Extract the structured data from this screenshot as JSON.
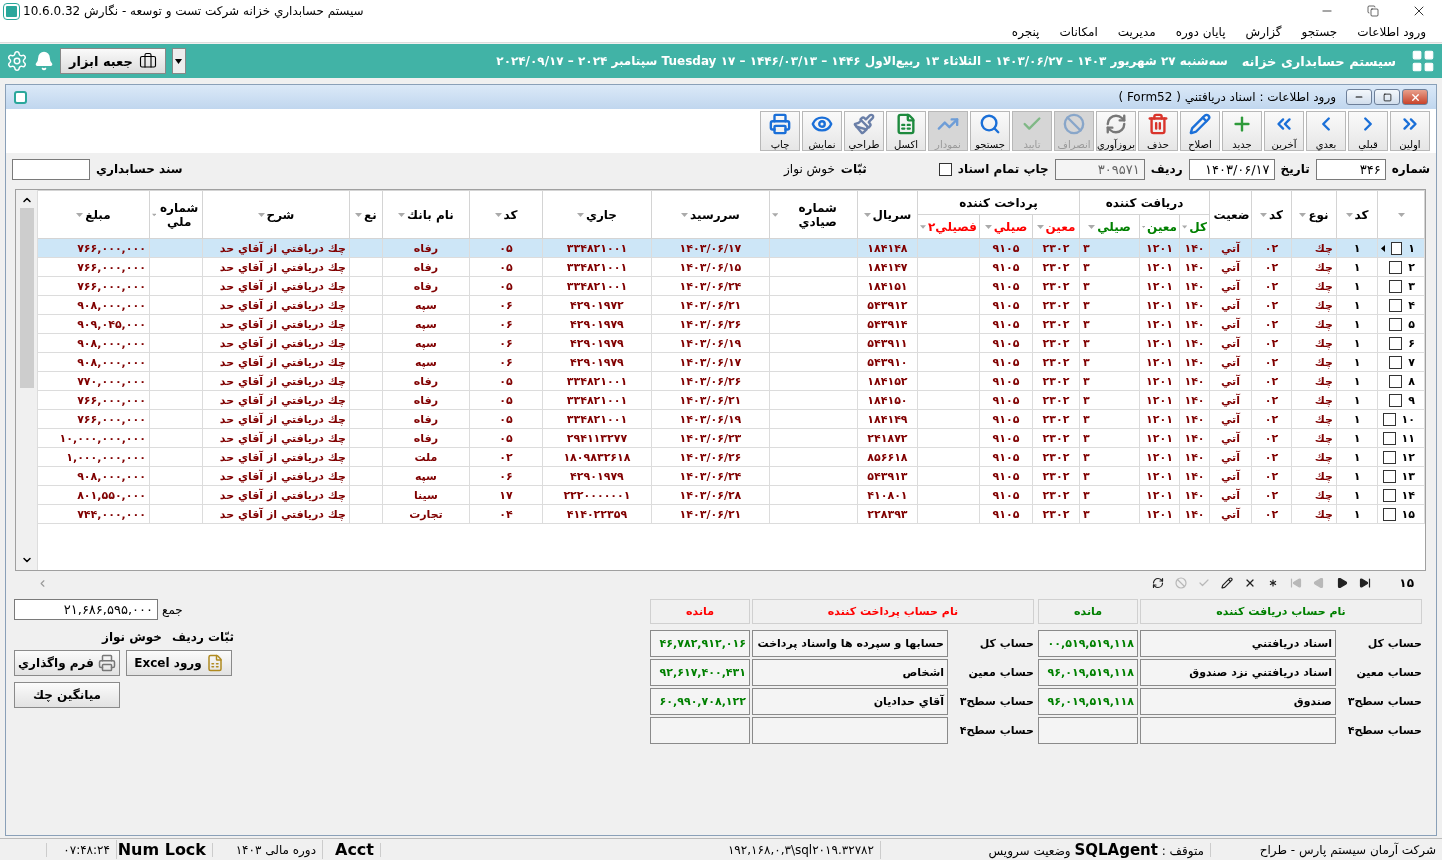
{
  "window": {
    "title": "سيستم حسابداري خزانه شركت تست و توسعه - نگارش 10.6.0.32"
  },
  "menu": [
    "ورود اطلاعات",
    "جستجو",
    "گزارش",
    "پايان دوره",
    "مديريت",
    "امكانات",
    "پنجره"
  ],
  "banner": {
    "title": "سيستم حسابداری خزانه",
    "date": "سه‌شنبه ۲۷ شهريور ۱۴۰۳ – ۱۴۰۳/۰۶/۲۷ – الثلاثاء ۱۳ ربيع‌الاول ۱۴۴۶ – ۱۴۴۶/۰۳/۱۳ – ۱۷ Tuesday سپتامبر ۲۰۲۴ – ۲۰۲۴/۰۹/۱۷",
    "toolbox": "جعبه ابزار"
  },
  "form": {
    "title": "ورود اطلاعات : اسناد دريافتني ( Form52 )",
    "toolbar": [
      {
        "kind": "first",
        "label": "اولين",
        "disabled": false
      },
      {
        "kind": "prev",
        "label": "قبلي",
        "disabled": false
      },
      {
        "kind": "next",
        "label": "بعدي",
        "disabled": false
      },
      {
        "kind": "last",
        "label": "آخرين",
        "disabled": false
      },
      {
        "kind": "new",
        "label": "جديد",
        "disabled": false
      },
      {
        "kind": "edit",
        "label": "اصلاح",
        "disabled": false
      },
      {
        "kind": "delete",
        "label": "حذف",
        "disabled": false
      },
      {
        "kind": "refresh",
        "label": "بروزآوري",
        "disabled": false
      },
      {
        "kind": "cancel",
        "label": "انصراف",
        "disabled": true
      },
      {
        "kind": "confirm",
        "label": "تاييد",
        "disabled": true
      },
      {
        "kind": "search",
        "label": "جستجو",
        "disabled": false
      },
      {
        "kind": "chart",
        "label": "نمودار",
        "disabled": true
      },
      {
        "kind": "excel",
        "label": "اكسل",
        "disabled": false
      },
      {
        "kind": "design",
        "label": "طراحي",
        "disabled": false
      },
      {
        "kind": "view",
        "label": "نمايش",
        "disabled": false
      },
      {
        "kind": "print",
        "label": "چاپ",
        "disabled": false
      }
    ],
    "number": {
      "label": "شماره",
      "value": "۳۴۶"
    },
    "date": {
      "label": "تاريخ",
      "value": "۱۴۰۳/۰۶/۱۷"
    },
    "row": {
      "label": "رديف",
      "value": "۳۰۹۵۷۱",
      "disabled": true
    },
    "print_all": {
      "label": "چاپ تمام اسناد",
      "checked": false
    },
    "clerk": {
      "label": "ثبّات",
      "value": "خوش نواز"
    },
    "voucher": {
      "label": "سند حسابداري"
    }
  },
  "table": {
    "groups": [
      "دريافت كننده",
      "پرداخت كننده"
    ],
    "columns": [
      {
        "label": "كد"
      },
      {
        "label": "نوع"
      },
      {
        "label": "كد"
      },
      {
        "label": "ضعيت"
      },
      {
        "label": "كل",
        "color": "#008000"
      },
      {
        "label": "معين",
        "color": "#008000"
      },
      {
        "label": "صيلي",
        "color": "#008000"
      },
      {
        "label": "معين",
        "color": "#ff0000"
      },
      {
        "label": "صيلي",
        "color": "#ff0000"
      },
      {
        "label": "فصيلي۲",
        "color": "#ff0000"
      },
      {
        "label": "سريال"
      },
      {
        "label": "شماره صيادي"
      },
      {
        "label": "سررسيد"
      },
      {
        "label": "جاري"
      },
      {
        "label": "كد"
      },
      {
        "label": "نام بانك"
      },
      {
        "label": "نع"
      },
      {
        "label": "شرح"
      },
      {
        "label": "شماره ملي"
      },
      {
        "label": "مبلغ"
      }
    ],
    "rows": [
      {
        "number": "۱",
        "checked": false,
        "selected": true,
        "cells": [
          "۱",
          "چك",
          "۰۲",
          "آتي",
          "۱۴۰",
          "۱۲۰۱",
          "۳",
          "۲۳۰۲",
          "۹۱۰۵",
          null,
          "۱۸۴۱۴۸",
          null,
          "۱۴۰۳/۰۶/۱۷",
          "۳۳۴۸۲۱۰۰۱",
          "۰۵",
          "رفاه",
          null,
          "چك دريافتي از آقاي حد",
          null,
          "۷۶۶,۰۰۰,۰۰۰"
        ]
      },
      {
        "number": "۲",
        "checked": false,
        "selected": false,
        "cells": [
          "۱",
          "چك",
          "۰۲",
          "آتي",
          "۱۴۰",
          "۱۲۰۱",
          "۳",
          "۲۳۰۲",
          "۹۱۰۵",
          null,
          "۱۸۴۱۴۷",
          null,
          "۱۴۰۳/۰۶/۱۵",
          "۳۳۴۸۲۱۰۰۱",
          "۰۵",
          "رفاه",
          null,
          "چك دريافتي از آقاي حد",
          null,
          "۷۶۶,۰۰۰,۰۰۰"
        ]
      },
      {
        "number": "۳",
        "checked": false,
        "selected": false,
        "cells": [
          "۱",
          "چك",
          "۰۲",
          "آتي",
          "۱۴۰",
          "۱۲۰۱",
          "۳",
          "۲۳۰۲",
          "۹۱۰۵",
          null,
          "۱۸۴۱۵۱",
          null,
          "۱۴۰۳/۰۶/۲۴",
          "۳۳۴۸۲۱۰۰۱",
          "۰۵",
          "رفاه",
          null,
          "چك دريافتي از آقاي حد",
          null,
          "۷۶۶,۰۰۰,۰۰۰"
        ]
      },
      {
        "number": "۴",
        "checked": false,
        "selected": false,
        "cells": [
          "۱",
          "چك",
          "۰۲",
          "آتي",
          "۱۴۰",
          "۱۲۰۱",
          "۳",
          "۲۳۰۲",
          "۹۱۰۵",
          null,
          "۵۴۳۹۱۲",
          null,
          "۱۴۰۳/۰۶/۲۱",
          "۴۲۹۰۱۹۷۲",
          "۰۶",
          "سپه",
          null,
          "چك دريافتي از آقاي حد",
          null,
          "۹۰۸,۰۰۰,۰۰۰"
        ]
      },
      {
        "number": "۵",
        "checked": false,
        "selected": false,
        "cells": [
          "۱",
          "چك",
          "۰۲",
          "آتي",
          "۱۴۰",
          "۱۲۰۱",
          "۳",
          "۲۳۰۲",
          "۹۱۰۵",
          null,
          "۵۴۳۹۱۴",
          null,
          "۱۴۰۳/۰۶/۲۶",
          "۴۲۹۰۱۹۷۹",
          "۰۶",
          "سپه",
          null,
          "چك دريافتي از آقاي حد",
          null,
          "۹۰۹,۰۴۵,۰۰۰"
        ]
      },
      {
        "number": "۶",
        "checked": false,
        "selected": false,
        "cells": [
          "۱",
          "چك",
          "۰۲",
          "آتي",
          "۱۴۰",
          "۱۲۰۱",
          "۳",
          "۲۳۰۲",
          "۹۱۰۵",
          null,
          "۵۴۳۹۱۱",
          null,
          "۱۴۰۳/۰۶/۱۹",
          "۴۲۹۰۱۹۷۹",
          "۰۶",
          "سپه",
          null,
          "چك دريافتي از آقاي حد",
          null,
          "۹۰۸,۰۰۰,۰۰۰"
        ]
      },
      {
        "number": "۷",
        "checked": false,
        "selected": false,
        "cells": [
          "۱",
          "چك",
          "۰۲",
          "آتي",
          "۱۴۰",
          "۱۲۰۱",
          "۳",
          "۲۳۰۲",
          "۹۱۰۵",
          null,
          "۵۴۳۹۱۰",
          null,
          "۱۴۰۳/۰۶/۱۷",
          "۴۲۹۰۱۹۷۹",
          "۰۶",
          "سپه",
          null,
          "چك دريافتي از آقاي حد",
          null,
          "۹۰۸,۰۰۰,۰۰۰"
        ]
      },
      {
        "number": "۸",
        "checked": false,
        "selected": false,
        "cells": [
          "۱",
          "چك",
          "۰۲",
          "آتي",
          "۱۴۰",
          "۱۲۰۱",
          "۳",
          "۲۳۰۲",
          "۹۱۰۵",
          null,
          "۱۸۴۱۵۲",
          null,
          "۱۴۰۳/۰۶/۲۶",
          "۳۳۴۸۲۱۰۰۱",
          "۰۵",
          "رفاه",
          null,
          "چك دريافتي از آقاي حد",
          null,
          "۷۷۰,۰۰۰,۰۰۰"
        ]
      },
      {
        "number": "۹",
        "checked": false,
        "selected": false,
        "cells": [
          "۱",
          "چك",
          "۰۲",
          "آتي",
          "۱۴۰",
          "۱۲۰۱",
          "۳",
          "۲۳۰۲",
          "۹۱۰۵",
          null,
          "۱۸۴۱۵۰",
          null,
          "۱۴۰۳/۰۶/۲۱",
          "۳۳۴۸۲۱۰۰۱",
          "۰۵",
          "رفاه",
          null,
          "چك دريافتي از آقاي حد",
          null,
          "۷۶۶,۰۰۰,۰۰۰"
        ]
      },
      {
        "number": "۱۰",
        "checked": false,
        "selected": false,
        "cells": [
          "۱",
          "چك",
          "۰۲",
          "آتي",
          "۱۴۰",
          "۱۲۰۱",
          "۳",
          "۲۳۰۲",
          "۹۱۰۵",
          null,
          "۱۸۴۱۴۹",
          null,
          "۱۴۰۳/۰۶/۱۹",
          "۳۳۴۸۲۱۰۰۱",
          "۰۵",
          "رفاه",
          null,
          "چك دريافتي از آقاي حد",
          null,
          "۷۶۶,۰۰۰,۰۰۰"
        ]
      },
      {
        "number": "۱۱",
        "checked": false,
        "selected": false,
        "cells": [
          "۱",
          "چك",
          "۰۲",
          "آتي",
          "۱۴۰",
          "۱۲۰۱",
          "۳",
          "۲۳۰۲",
          "۹۱۰۵",
          null,
          "۲۴۱۸۷۲",
          null,
          "۱۴۰۳/۰۶/۲۳",
          "۲۹۴۱۱۳۲۷۷",
          "۰۵",
          "رفاه",
          null,
          "چك دريافتي از آقاي حد",
          null,
          "۱۰,۰۰۰,۰۰۰,۰۰۰"
        ]
      },
      {
        "number": "۱۲",
        "checked": false,
        "selected": false,
        "cells": [
          "۱",
          "چك",
          "۰۲",
          "آتي",
          "۱۴۰",
          "۱۲۰۱",
          "۳",
          "۲۳۰۲",
          "۹۱۰۵",
          null,
          "۸۵۶۶۱۸",
          null,
          "۱۴۰۳/۰۶/۲۶",
          "۱۸۰۹۸۳۲۶۱۸",
          "۰۲",
          "ملت",
          null,
          "چك دريافتي از آقاي حد",
          null,
          "۱,۰۰۰,۰۰۰,۰۰۰"
        ]
      },
      {
        "number": "۱۳",
        "checked": false,
        "selected": false,
        "cells": [
          "۱",
          "چك",
          "۰۲",
          "آتي",
          "۱۴۰",
          "۱۲۰۱",
          "۳",
          "۲۳۰۲",
          "۹۱۰۵",
          null,
          "۵۴۳۹۱۳",
          null,
          "۱۴۰۳/۰۶/۲۴",
          "۴۲۹۰۱۹۷۹",
          "۰۶",
          "سپه",
          null,
          "چك دريافتي از آقاي حد",
          null,
          "۹۰۸,۰۰۰,۰۰۰"
        ]
      },
      {
        "number": "۱۴",
        "checked": false,
        "selected": false,
        "cells": [
          "۱",
          "چك",
          "۰۲",
          "آتي",
          "۱۴۰",
          "۱۲۰۱",
          "۳",
          "۲۳۰۲",
          "۹۱۰۵",
          null,
          "۴۱۰۸۰۱",
          null,
          "۱۴۰۳/۰۶/۲۸",
          "۲۲۲۰۰۰۰۰۰۱",
          "۱۷",
          "سينا",
          null,
          "چك دريافتي از آقاي حد",
          null,
          "۸۰۱,۵۵۰,۰۰۰"
        ]
      },
      {
        "number": "۱۵",
        "checked": false,
        "selected": false,
        "cells": [
          "۱",
          "چك",
          "۰۲",
          "آتي",
          "۱۴۰",
          "۱۲۰۱",
          "۳",
          "۲۳۰۲",
          "۹۱۰۵",
          null,
          "۲۲۸۳۹۳",
          null,
          "۱۴۰۳/۰۶/۲۱",
          "۴۱۴۰۲۲۳۵۹",
          "۰۴",
          "تجارت",
          null,
          "چك دريافتي از آقاي حد",
          null,
          "۷۴۴,۰۰۰,۰۰۰"
        ]
      }
    ]
  },
  "navigator": {
    "count": "۱۵",
    "buttons": [
      {
        "kind": "first",
        "disabled": false
      },
      {
        "kind": "prior",
        "disabled": false
      },
      {
        "kind": "next",
        "disabled": true
      },
      {
        "kind": "last",
        "disabled": true
      },
      {
        "kind": "insert",
        "disabled": false
      },
      {
        "kind": "delete",
        "disabled": false
      },
      {
        "kind": "edit",
        "disabled": false
      },
      {
        "kind": "post",
        "disabled": true
      },
      {
        "kind": "cancel",
        "disabled": true
      },
      {
        "kind": "refresh",
        "disabled": false
      }
    ]
  },
  "summary": {
    "total": {
      "label": "جمع",
      "value": "۲۱,۶۸۶,۵۹۵,۰۰۰"
    },
    "row_clerk": {
      "label": "ثبّات رديف",
      "value": "خوش نواز"
    },
    "buttons": [
      {
        "kind": "excel",
        "label": "ورود Excel"
      },
      {
        "kind": "form",
        "label": "فرم واگذاري"
      },
      {
        "kind": "average",
        "label": "ميانگين چك"
      }
    ]
  },
  "accounts": [
    {
      "title": "نام حساب دريافت كننده",
      "balance_label": "مانده",
      "color": "#008000",
      "rows": [
        {
          "label": "حساب كل",
          "name": "اسناد دريافتني",
          "balance": "۰۰,۵۱۹,۵۱۹,۱۱۸"
        },
        {
          "label": "حساب معين",
          "name": "اسناد دريافتني نزد صندوق",
          "balance": "۹۶,۰۱۹,۵۱۹,۱۱۸"
        },
        {
          "label": "حساب سطح۳",
          "name": "صندوق",
          "balance": "۹۶,۰۱۹,۵۱۹,۱۱۸"
        },
        {
          "label": "حساب سطح۴"
        }
      ]
    },
    {
      "title": "نام حساب پرداخت كننده",
      "balance_label": "مانده",
      "color": "#ff0000",
      "rows": [
        {
          "label": "حساب كل",
          "name": "حسابها و سپرده ها واسناد پرداخت",
          "balance": "۴۶,۷۸۲,۹۱۲,۰۱۶"
        },
        {
          "label": "حساب معين",
          "name": "اشخاص",
          "balance": "۹۲,۶۱۷,۴۰۰,۴۳۱"
        },
        {
          "label": "حساب سطح۳",
          "name": "آقاي حداديان",
          "balance": "۶۰,۹۹۰,۷۰۸,۱۲۲"
        },
        {
          "label": "حساب سطح۴"
        }
      ]
    }
  ],
  "status_bar": [
    "شركت آرمان سيستم پارس - طراح",
    "متوقف : **SQLAgent** وضعيت سرويس",
    "۱۹۲,۱۶۸,۰,۳\\sql۲۰۱۹.۳۲۷۸۲",
    "Acct",
    "دوره مالی ۱۴۰۳",
    "Num Lock",
    "۰۷:۴۸:۲۴"
  ]
}
